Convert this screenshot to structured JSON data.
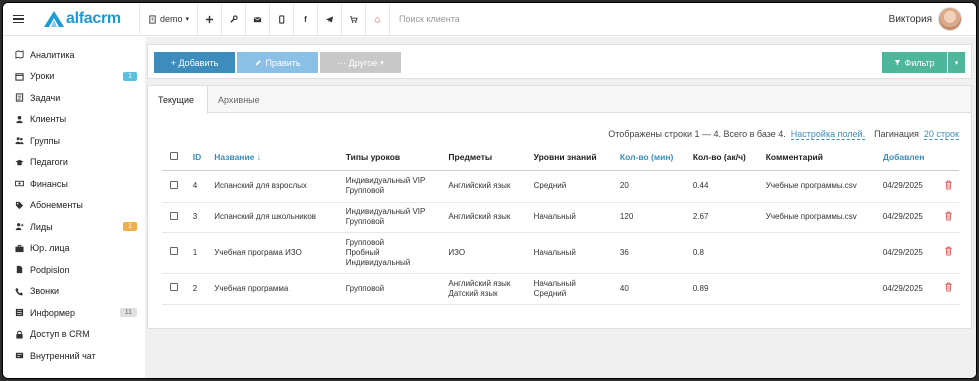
{
  "app": {
    "logo_text": "alfacrm",
    "branch": "demo",
    "search_placeholder": "Поиск клиента",
    "user_name": "Виктория",
    "colors": {
      "brand": "#1a9bd7",
      "primary": "#3c8dbc",
      "filter": "#4db69b"
    }
  },
  "topbar_icons": [
    "plus-icon",
    "wrench-icon",
    "mail-icon",
    "phone-icon",
    "facebook-icon",
    "telegram-icon",
    "cart-icon",
    "bell-icon"
  ],
  "sidebar": {
    "items": [
      {
        "label": "Аналитика",
        "icon": "map-icon"
      },
      {
        "label": "Уроки",
        "icon": "calendar-icon",
        "badge": "1",
        "badge_color": "blue"
      },
      {
        "label": "Задачи",
        "icon": "tasks-icon"
      },
      {
        "label": "Клиенты",
        "icon": "user-icon"
      },
      {
        "label": "Группы",
        "icon": "group-icon"
      },
      {
        "label": "Педагоги",
        "icon": "graduation-cap-icon"
      },
      {
        "label": "Финансы",
        "icon": "money-icon"
      },
      {
        "label": "Абонементы",
        "icon": "tag-icon"
      },
      {
        "label": "Лиды",
        "icon": "user-plus-icon",
        "badge": "1",
        "badge_color": "orange"
      },
      {
        "label": "Юр. лица",
        "icon": "briefcase-icon"
      },
      {
        "label": "Podpislon",
        "icon": "document-icon"
      },
      {
        "label": "Звонки",
        "icon": "phone-call-icon"
      },
      {
        "label": "Информер",
        "icon": "list-icon",
        "badge": "11",
        "badge_color": "gray"
      },
      {
        "label": "Доступ в CRM",
        "icon": "lock-icon"
      },
      {
        "label": "Внутренний чат",
        "icon": "chat-icon"
      }
    ]
  },
  "toolbar": {
    "add_label": "+ Добавить",
    "edit_label": "Править",
    "other_label": "··· Другое",
    "filter_label": "Фильтр"
  },
  "tabs": {
    "current": "Текущие",
    "archive": "Архивные"
  },
  "info": {
    "shown": "Отображены строки 1 — 4. Всего в базе 4.",
    "settings_link": "Настройка полей.",
    "pagination_label": "Пагинация",
    "pagination_value": "20 строк"
  },
  "table": {
    "headers": {
      "id": "ID",
      "name": "Название ↓",
      "types": "Типы уроков",
      "subjects": "Предметы",
      "levels": "Уровни знаний",
      "count_min": "Кол-во (мин)",
      "count_ac": "Кол-во (ак/ч)",
      "comment": "Комментарий",
      "added": "Добавлен"
    },
    "rows": [
      {
        "id": "4",
        "name": "Испанский для взрослых",
        "types": [
          "Индивидуальный VIP",
          "Групповой"
        ],
        "subjects": [
          "Английский язык"
        ],
        "levels": [
          "Средний"
        ],
        "count_min": "20",
        "count_ac": "0.44",
        "comment": "Учебные программы.csv",
        "added": "04/29/2025"
      },
      {
        "id": "3",
        "name": "Испанский для школьников",
        "types": [
          "Индивидуальный VIP",
          "Групповой"
        ],
        "subjects": [
          "Английский язык"
        ],
        "levels": [
          "Начальный"
        ],
        "count_min": "120",
        "count_ac": "2.67",
        "comment": "Учебные программы.csv",
        "added": "04/29/2025"
      },
      {
        "id": "1",
        "name": "Учебная програма ИЗО",
        "types": [
          "Групповой",
          "Пробный",
          "Индивидуальный"
        ],
        "subjects": [
          "ИЗО"
        ],
        "levels": [
          "Начальный"
        ],
        "count_min": "36",
        "count_ac": "0.8",
        "comment": "",
        "added": "04/29/2025"
      },
      {
        "id": "2",
        "name": "Учебная программа",
        "types": [
          "Групповой"
        ],
        "subjects": [
          "Английский язык",
          "Датский язык"
        ],
        "levels": [
          "Начальный",
          "Средний"
        ],
        "count_min": "40",
        "count_ac": "0.89",
        "comment": "",
        "added": "04/29/2025"
      }
    ]
  }
}
